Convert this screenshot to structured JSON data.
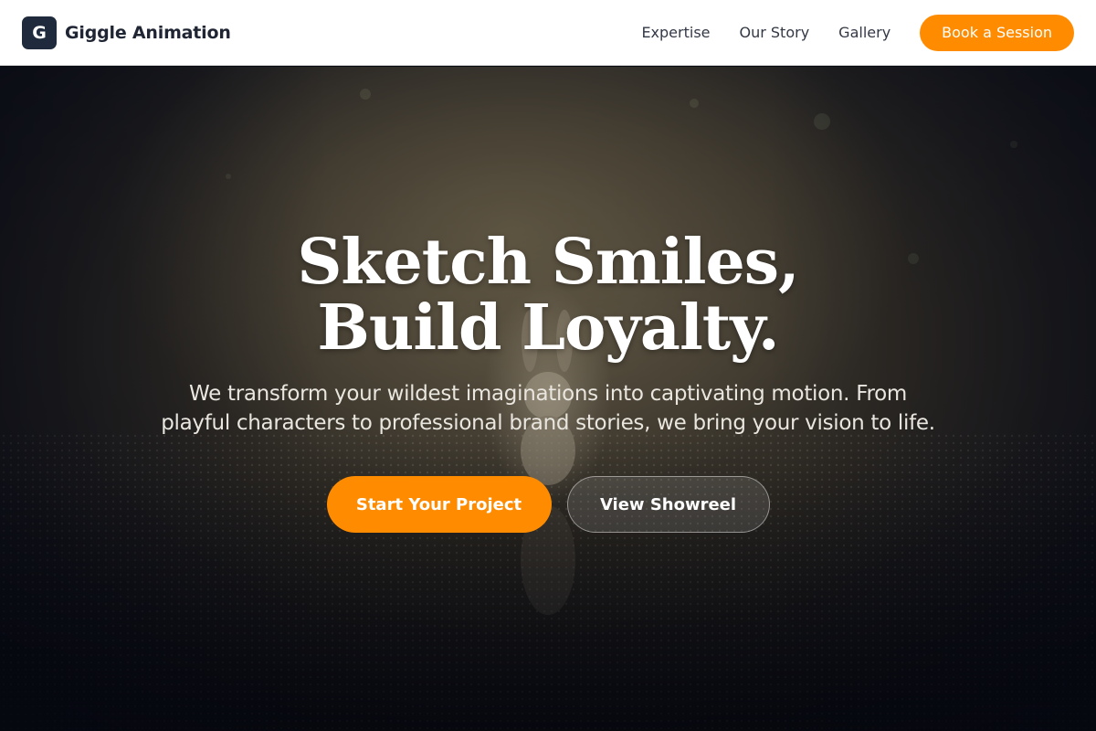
{
  "nav": {
    "logo_letter": "G",
    "brand_name": "Giggle Animation",
    "links": [
      {
        "label": "Expertise"
      },
      {
        "label": "Our Story"
      },
      {
        "label": "Gallery"
      }
    ],
    "cta_label": "Book a Session"
  },
  "hero": {
    "title": "Sketch Smiles, Build Loyalty.",
    "subtitle": "We transform your wildest imaginations into captivating motion. From playful characters to professional brand stories, we bring your vision to life.",
    "primary_label": "Start Your Project",
    "secondary_label": "View Showreel"
  },
  "colors": {
    "accent": "#ff8c00",
    "logo_bg": "#1f2a3d",
    "nav_bg": "#ffffff"
  }
}
